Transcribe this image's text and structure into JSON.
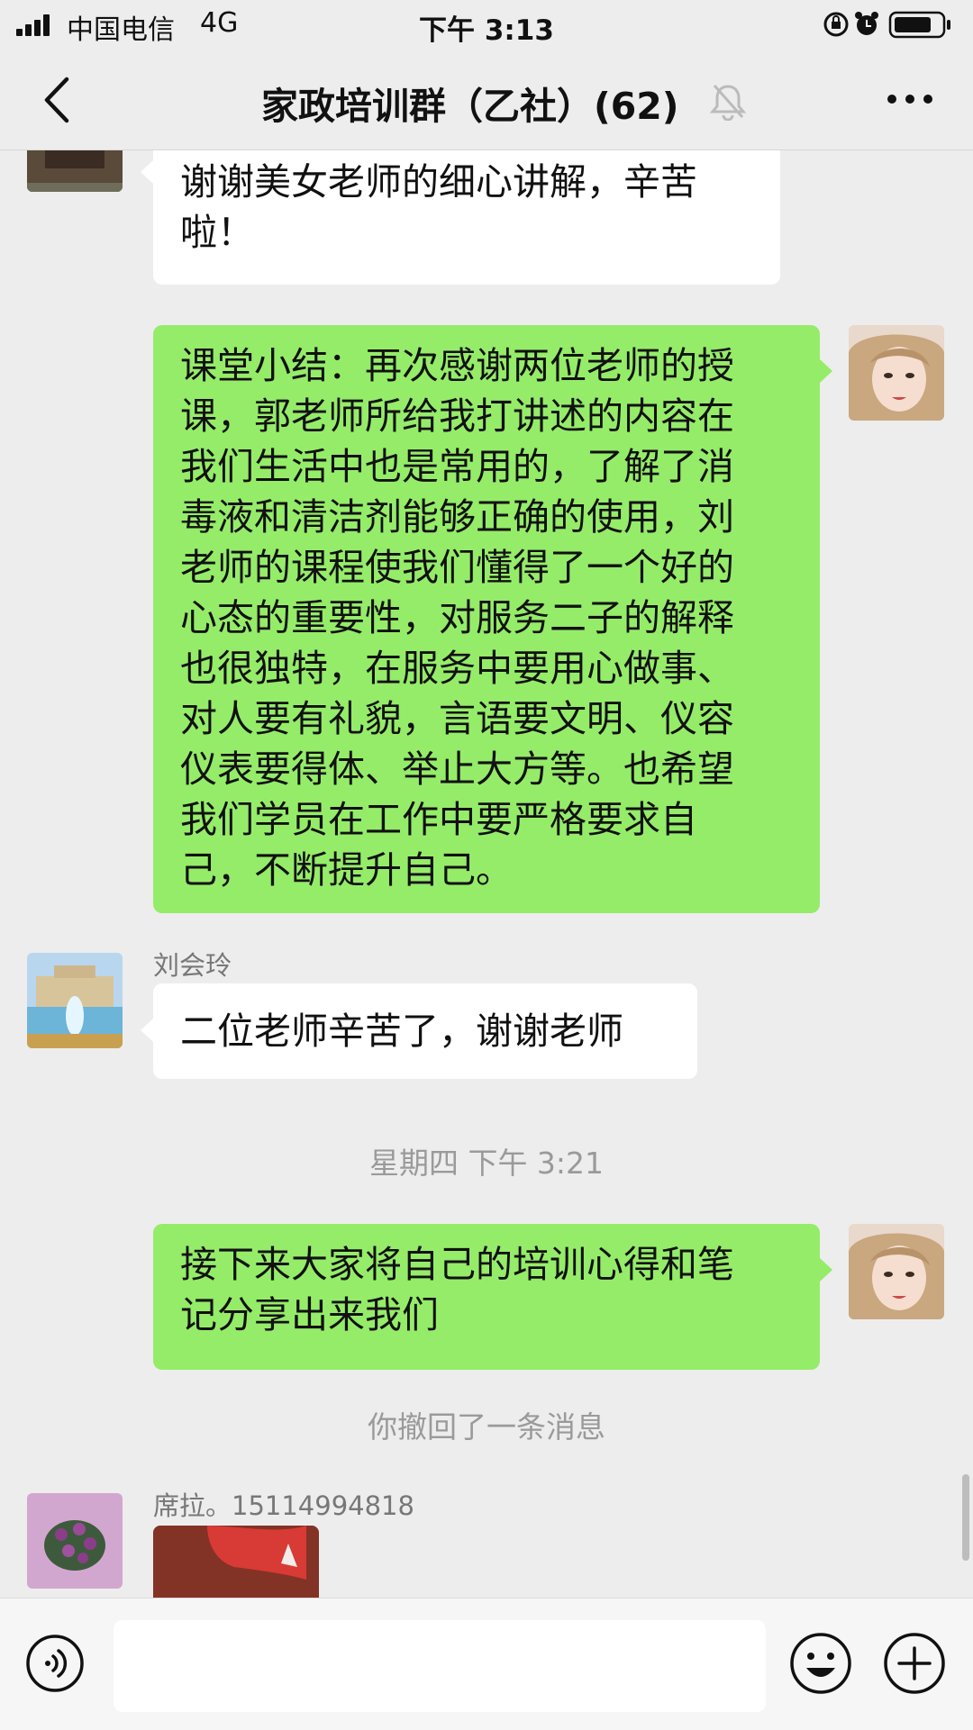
{
  "status_bar": {
    "carrier": "中国电信",
    "network": "4G",
    "time": "下午 3:13"
  },
  "nav": {
    "title": "家政培训群（乙社）(62)"
  },
  "messages": [
    {
      "text": "谢谢美女老师的细心讲解，辛苦\n啦！"
    },
    {
      "text": "课堂小结：再次感谢两位老师的授\n课，郭老师所给我打讲述的内容在\n我们生活中也是常用的，了解了消\n毒液和清洁剂能够正确的使用，刘\n老师的课程使我们懂得了一个好的\n心态的重要性，对服务二子的解释\n也很独特，在服务中要用心做事、\n对人要有礼貌，言语要文明、仪容\n仪表要得体、举止大方等。也希望\n我们学员在工作中要严格要求自\n己，不断提升自己。"
    },
    {
      "sender": "刘会玲",
      "text": "二位老师辛苦了，谢谢老师"
    },
    {
      "system": "星期四 下午 3:21"
    },
    {
      "text": "接下来大家将自己的培训心得和笔\n记分享出来我们"
    },
    {
      "system": "你撤回了一条消息"
    },
    {
      "sender": "席拉。15114994818",
      "image": true
    }
  ],
  "input": {
    "value": ""
  },
  "colors": {
    "background": "#ededed",
    "outgoing_bubble": "#95ec69",
    "incoming_bubble": "#ffffff"
  },
  "icons": [
    "signal-icon",
    "lock-rotation-icon",
    "alarm-icon",
    "battery-icon",
    "back-icon",
    "mute-bell-icon",
    "more-icon",
    "voice-icon",
    "emoji-icon",
    "plus-icon"
  ]
}
